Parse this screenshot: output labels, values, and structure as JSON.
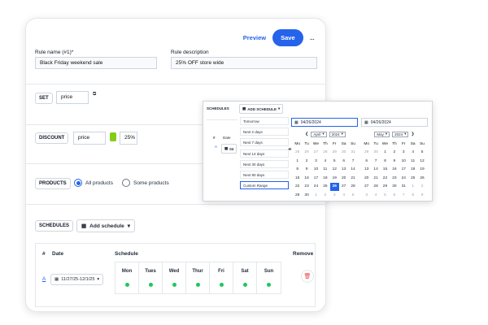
{
  "header": {
    "preview_label": "Preview",
    "save_label": "Save",
    "more_label": "..."
  },
  "rule": {
    "name_label": "Rule name (#1)*",
    "name_value": "Black Friday weekend sale",
    "desc_label": "Rule description",
    "desc_value": "25% OFF store wide"
  },
  "set": {
    "tag": "SET",
    "value": "price"
  },
  "discount": {
    "tag": "DISCOUNT",
    "value": "price",
    "percent": "25%"
  },
  "products": {
    "tag": "PRODUCTS",
    "all_label": "All products",
    "some_label": "Some products",
    "selected": "all"
  },
  "schedules": {
    "tag": "SCHEDULES",
    "add_label": "Add schedule",
    "table": {
      "hash": "#",
      "date": "Date",
      "schedule": "Schedule",
      "remove": "Remove",
      "row_letter": "A",
      "row_date": "11/27/25-12/1/25",
      "days": [
        "Mon",
        "Tues",
        "Wed",
        "Thur",
        "Fri",
        "Sat",
        "Sun"
      ]
    }
  },
  "popup": {
    "tag": "SCHEDULES",
    "add_label": "ADD SCHEDULE",
    "hash": "#",
    "date": "Date",
    "row_letter": "A",
    "row_date": "04",
    "ranges": [
      "Tomorrow",
      "Next 2 days",
      "Next 7 days",
      "Next 14 days",
      "Next 30 days",
      "Next 90 days",
      "Custom Range"
    ],
    "start_input": "04/26/2024",
    "end_input": "04/26/2024",
    "weekdays": [
      "Mo",
      "Tu",
      "We",
      "Th",
      "Fr",
      "Sa",
      "Su"
    ],
    "left_cal": {
      "month": "April",
      "year": "2024",
      "days": [
        "25",
        "26",
        "27",
        "28",
        "29",
        "30",
        "31",
        "1",
        "2",
        "3",
        "4",
        "5",
        "6",
        "7",
        "8",
        "9",
        "10",
        "11",
        "12",
        "13",
        "14",
        "15",
        "16",
        "17",
        "18",
        "19",
        "20",
        "21",
        "22",
        "23",
        "24",
        "25",
        "26",
        "27",
        "28",
        "29",
        "30",
        "1",
        "2",
        "3",
        "4",
        "5"
      ],
      "off": [
        0,
        1,
        2,
        3,
        4,
        5,
        6,
        37,
        38,
        39,
        40,
        41
      ],
      "selected": 32
    },
    "right_cal": {
      "month": "May",
      "year": "2024",
      "days": [
        "29",
        "30",
        "1",
        "2",
        "3",
        "4",
        "5",
        "6",
        "7",
        "8",
        "9",
        "10",
        "11",
        "12",
        "13",
        "14",
        "15",
        "16",
        "17",
        "18",
        "19",
        "20",
        "21",
        "22",
        "23",
        "24",
        "25",
        "26",
        "27",
        "28",
        "29",
        "30",
        "31",
        "1",
        "2",
        "3",
        "4",
        "5",
        "6",
        "7",
        "8",
        "9"
      ],
      "off": [
        0,
        1,
        33,
        34,
        35,
        36,
        37,
        38,
        39,
        40,
        41
      ],
      "selected": -1
    }
  },
  "colors": {
    "accent": "#2563eb",
    "success": "#22c55e",
    "danger": "#ef4444"
  }
}
